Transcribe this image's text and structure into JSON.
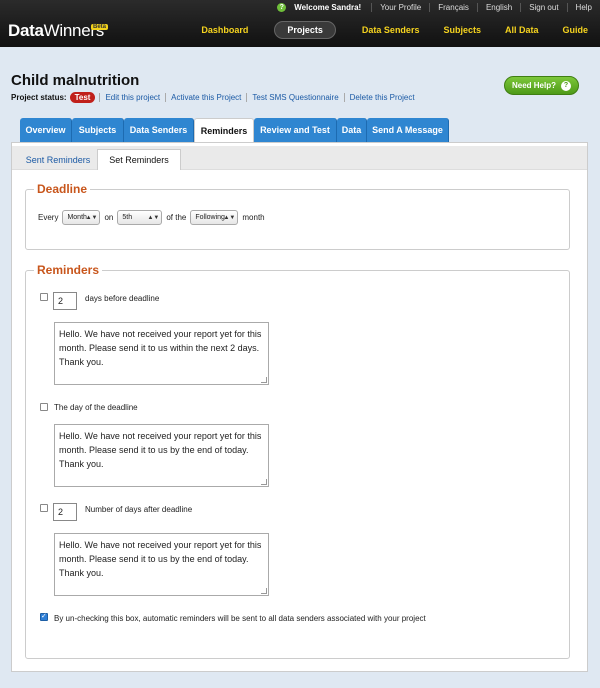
{
  "header": {
    "welcome": "Welcome Sandra!",
    "util_links": [
      "Your Profile",
      "Français",
      "English",
      "Sign out",
      "Help"
    ],
    "logo_bold": "Data",
    "logo_thin": "Winners",
    "beta": "Beta",
    "nav": [
      "Dashboard",
      "Projects",
      "Data Senders",
      "Subjects",
      "All Data",
      "Guide"
    ],
    "active_nav": "Projects"
  },
  "project": {
    "title": "Child malnutrition",
    "status_label": "Project status:",
    "status_badge": "Test",
    "actions": [
      "Edit this project",
      "Activate this Project",
      "Test SMS Questionnaire",
      "Delete this Project"
    ],
    "need_help": "Need Help?"
  },
  "tabs": [
    "Overview",
    "Subjects",
    "Data Senders",
    "Reminders",
    "Review and Test",
    "Data",
    "Send A Message"
  ],
  "active_tab": "Reminders",
  "subtabs": [
    "Sent Reminders",
    "Set Reminders"
  ],
  "active_subtab": "Set Reminders",
  "deadline": {
    "legend": "Deadline",
    "every": "Every",
    "frequency": "Month",
    "on": "on",
    "day": "5th",
    "of_the": "of the",
    "which": "Following",
    "month": "month"
  },
  "reminders": {
    "legend": "Reminders",
    "before": {
      "checked": false,
      "days": "2",
      "label": "days before deadline",
      "message": "Hello. We have not received your report yet for this month. Please send it to us within the next 2 days. Thank you."
    },
    "on_day": {
      "checked": false,
      "label": "The day of the deadline",
      "message": "Hello. We have not received your report yet for this month. Please send it to us by the end of today. Thank you."
    },
    "after": {
      "checked": false,
      "days": "2",
      "label": "Number of days after deadline",
      "message": "Hello. We have not received your report yet for this month. Please send it to us by the end of today. Thank you."
    },
    "auto": {
      "checked": true,
      "label": "By un-checking this box, automatic reminders will be sent to all data senders associated with your project"
    }
  },
  "colors": {
    "accent_blue": "#2f86d1",
    "nav_yellow": "#f5d31f",
    "legend_orange": "#c8561c",
    "test_red": "#c0201b",
    "help_green": "#5aaa22"
  }
}
